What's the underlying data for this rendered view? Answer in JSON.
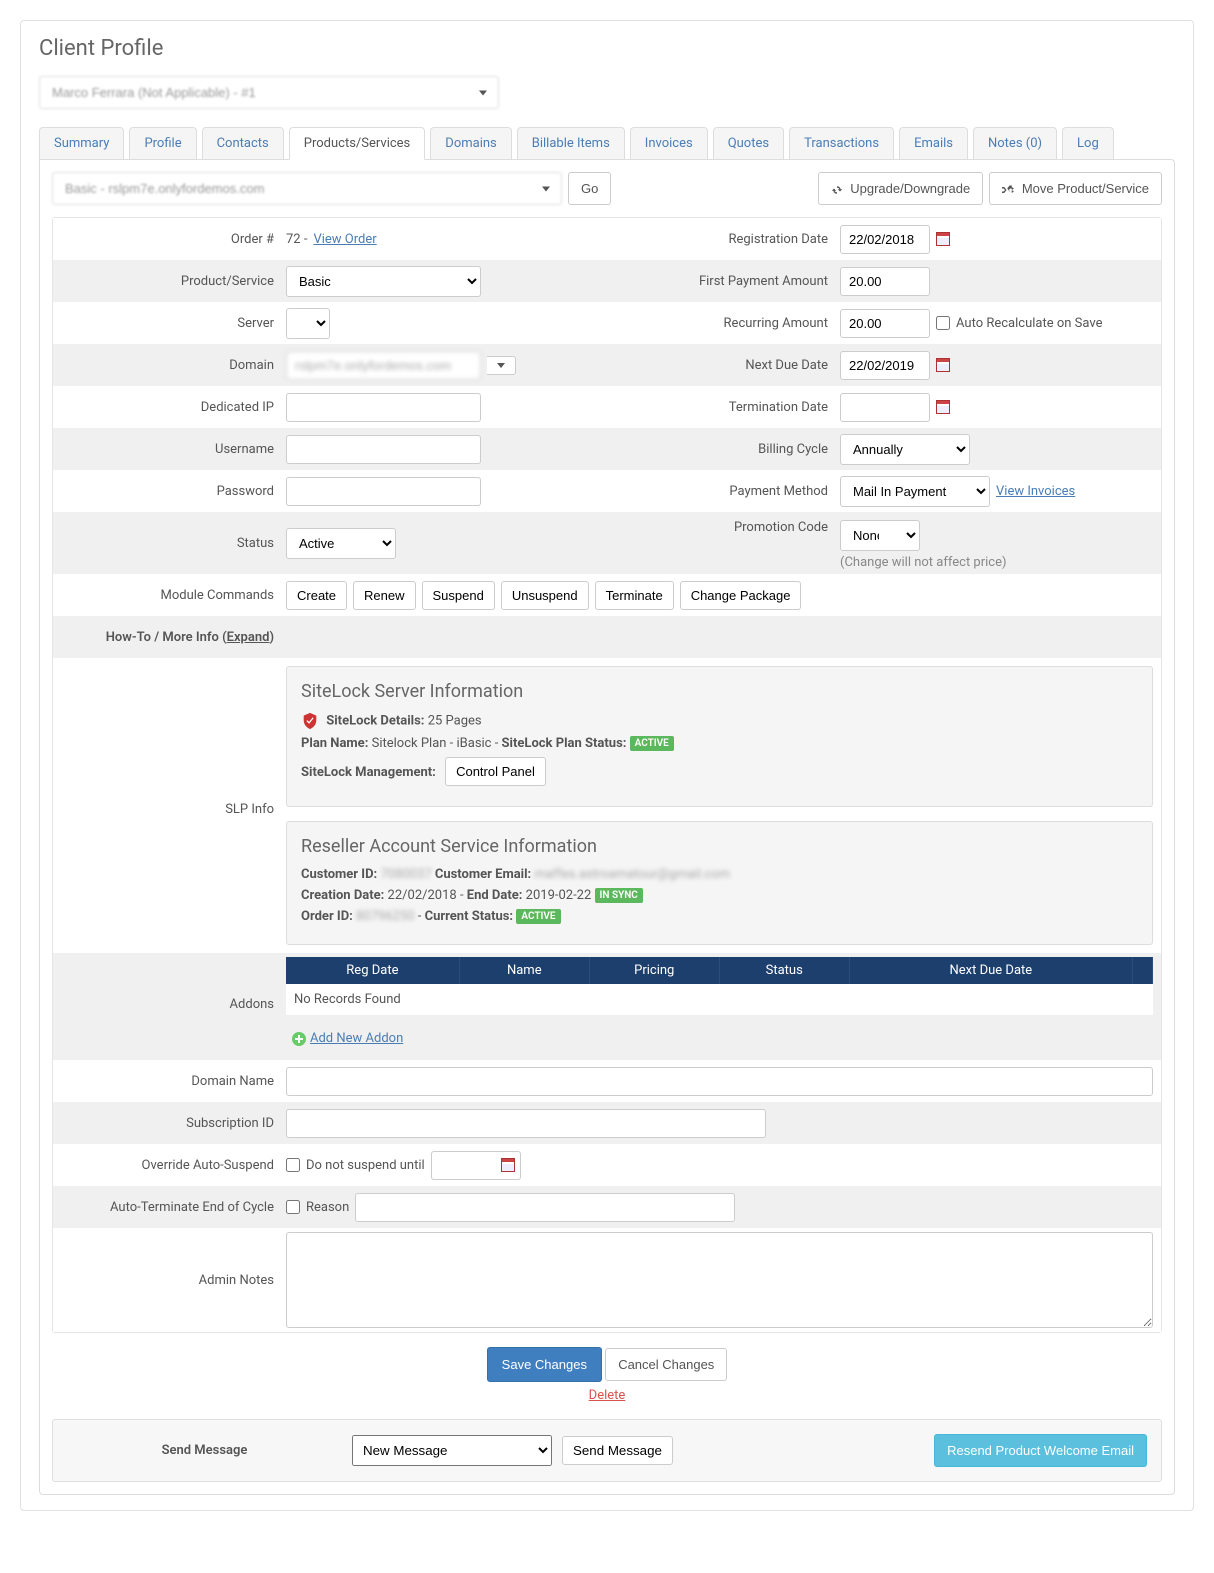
{
  "page_title": "Client Profile",
  "client_selected": "Marco Ferrara (Not Applicable) - #1",
  "tabs": [
    "Summary",
    "Profile",
    "Contacts",
    "Products/Services",
    "Domains",
    "Billable Items",
    "Invoices",
    "Quotes",
    "Transactions",
    "Emails",
    "Notes (0)",
    "Log"
  ],
  "active_tab": 3,
  "product_selected": "Basic - rslpm7e.onlyfordemos.com",
  "go_btn": "Go",
  "upgrade_btn": "Upgrade/Downgrade",
  "move_btn": "Move Product/Service",
  "left": {
    "order_label": "Order #",
    "order_value_prefix": "72 - ",
    "order_link": "View Order",
    "product_label": "Product/Service",
    "product_value": "Basic",
    "server_label": "Server",
    "domain_label": "Domain",
    "domain_value": "rslpm7e.onlyfordemos.com",
    "dedicated_ip_label": "Dedicated IP",
    "username_label": "Username",
    "password_label": "Password",
    "status_label": "Status",
    "status_value": "Active",
    "module_label": "Module Commands",
    "module_buttons": [
      "Create",
      "Renew",
      "Suspend",
      "Unsuspend",
      "Terminate",
      "Change Package"
    ],
    "howto_label_a": "How-To / More Info (",
    "howto_link": "Expand",
    "howto_label_b": ")",
    "slp_label": "SLP Info",
    "addons_label": "Addons",
    "domain_name_label": "Domain Name",
    "subscription_label": "Subscription ID",
    "override_label": "Override Auto-Suspend",
    "override_check": "Do not suspend until",
    "autoterm_label": "Auto-Terminate End of Cycle",
    "autoterm_check": "Reason",
    "notes_label": "Admin Notes"
  },
  "right": {
    "reg_label": "Registration Date",
    "reg_value": "22/02/2018",
    "first_pay_label": "First Payment Amount",
    "first_pay_value": "20.00",
    "recurring_label": "Recurring Amount",
    "recurring_value": "20.00",
    "auto_recalc": "Auto Recalculate on Save",
    "next_due_label": "Next Due Date",
    "next_due_value": "22/02/2019",
    "term_label": "Termination Date",
    "billing_label": "Billing Cycle",
    "billing_value": "Annually",
    "payment_label": "Payment Method",
    "payment_value": "Mail In Payment",
    "view_invoices": "View Invoices",
    "promo_label": "Promotion Code",
    "promo_value": "None",
    "promo_note": "(Change will not affect price)"
  },
  "sitelock": {
    "title": "SiteLock Server Information",
    "details_label": "SiteLock Details:",
    "details_value": "25 Pages",
    "plan_name_label": "Plan Name:",
    "plan_name_value": "Sitelock Plan - iBasic",
    "plan_status_label": "SiteLock Plan Status:",
    "plan_status_badge": "ACTIVE",
    "mgmt_label": "SiteLock Management:",
    "control_panel": "Control Panel"
  },
  "reseller": {
    "title": "Reseller Account Service Information",
    "cust_id_label": "Customer ID:",
    "cust_id_value": "7080037",
    "cust_email_label": "Customer Email:",
    "cust_email_value": "maffes.astroamatour@gmail.com",
    "creation_label": "Creation Date:",
    "creation_value": "22/02/2018",
    "end_label": "End Date:",
    "end_value": "2019-02-22",
    "sync_badge": "IN SYNC",
    "order_id_label": "Order ID:",
    "order_id_value": "80796250",
    "current_status_label": "Current Status:",
    "current_status_badge": "ACTIVE"
  },
  "addons": {
    "cols": [
      "Reg Date",
      "Name",
      "Pricing",
      "Status",
      "Next Due Date"
    ],
    "empty": "No Records Found",
    "add_new": "Add New Addon"
  },
  "actions": {
    "save": "Save Changes",
    "cancel": "Cancel Changes",
    "delete": "Delete"
  },
  "message": {
    "label": "Send Message",
    "select_value": "New Message",
    "send_btn": "Send Message",
    "resend_btn": "Resend Product Welcome Email"
  }
}
